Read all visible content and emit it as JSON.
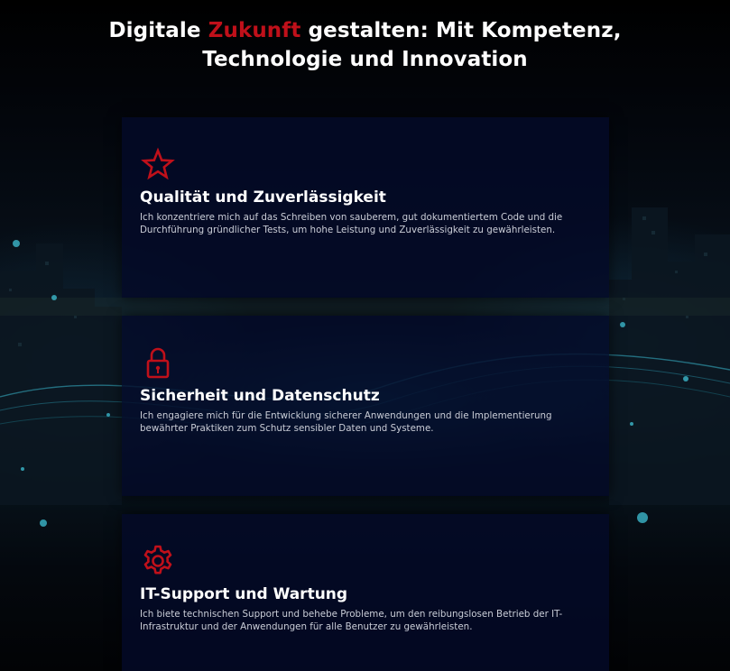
{
  "headline": {
    "part1": "Digitale ",
    "accent": "Zukunft",
    "part2": " gestalten: Mit Kompetenz,",
    "line2": "Technologie und Innovation"
  },
  "colors": {
    "accent": "#c0101a",
    "card_background": "#040a28",
    "text": "#ffffff",
    "body_text": "#c9ccd6"
  },
  "cards": [
    {
      "icon": "star-icon",
      "title": "Qualität und Zuverlässigkeit",
      "text": "Ich konzentriere mich auf das Schreiben von sauberem, gut dokumentiertem Code und die Durchführung gründlicher Tests, um hohe Leistung und Zuverlässigkeit zu gewährleisten."
    },
    {
      "icon": "lock-icon",
      "title": "Sicherheit und Datenschutz",
      "text": "Ich engagiere mich für die Entwicklung sicherer Anwendungen und die Implementierung bewährter Praktiken zum Schutz sensibler Daten und Systeme."
    },
    {
      "icon": "gear-icon",
      "title": "IT-Support und Wartung",
      "text": "Ich biete technischen Support und behebe Probleme, um den reibungslosen Betrieb der IT-Infrastruktur und der Anwendungen für alle Benutzer zu gewährleisten."
    }
  ]
}
